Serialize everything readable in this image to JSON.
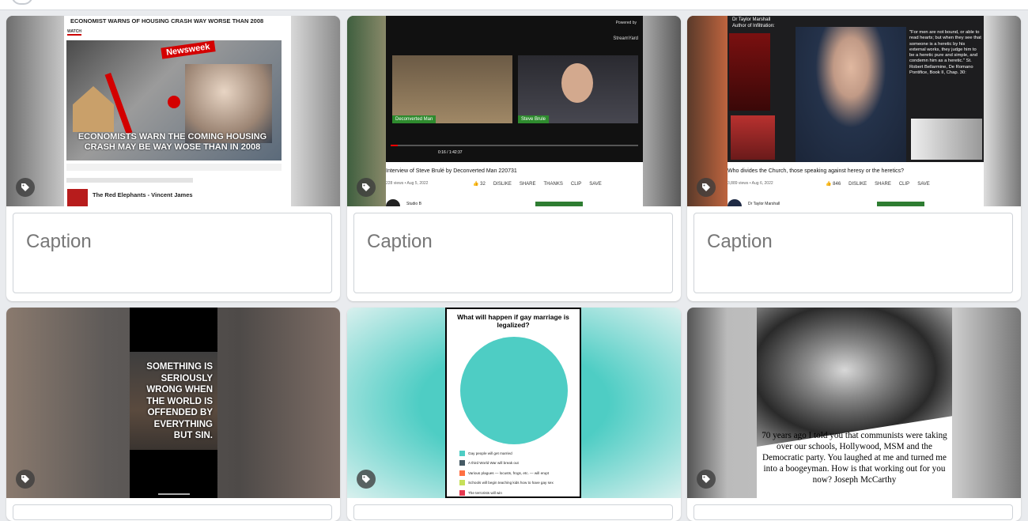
{
  "caption_placeholder": "Caption",
  "cards": [
    {
      "headline": "ECONOMIST WARNS OF HOUSING CRASH WAY WORSE THAN 2008",
      "watch": "WATCH",
      "overlay": "ECONOMISTS WARN THE COMING HOUSING CRASH MAY BE WAY WOSE THAN IN 2008",
      "channel": "The Red Elephants - Vincent James",
      "newsweek": "Newsweek",
      "caption": "Caption"
    },
    {
      "powered": "Powered by",
      "streamyard": "StreamYard",
      "guest_left": "Deconverted Man",
      "guest_right": "Steve Brule",
      "time": "0:16 / 1:42:37",
      "title": "Interview of Steve Brulé by Deconverted Man 220731",
      "meta": "228 views • Aug 5, 2022",
      "likes": "32",
      "dislike": "DISLIKE",
      "share": "SHARE",
      "thanks": "THANKS",
      "clip": "CLIP",
      "save": "SAVE",
      "channel": "Studio B",
      "caption": "Caption"
    },
    {
      "author": "Dr Taylor Marshall",
      "book": "Author of Infiltration:",
      "quote": "\"For men are not bound, or able to read hearts; but when they see that someone is a heretic by his external works, they judge him to be a heretic pure and simple, and condemn him as a heretic.\" St. Robert Bellarmine, De Romano Pontifice, Book II, Chap. 30:",
      "title": "Who divides the Church, those speaking against heresy or the heretics?",
      "meta": "3,889 views • Aug 6, 2022",
      "likes": "846",
      "dislike": "DISLIKE",
      "share": "SHARE",
      "clip": "CLIP",
      "save": "SAVE",
      "channel": "Dr Taylor Marshall",
      "caption": "Caption"
    },
    {
      "text": "SOMETHING IS SERIOUSLY WRONG WHEN THE WORLD IS OFFENDED BY EVERYTHING BUT SIN."
    },
    {
      "title": "What will happen if gay marriage is legalized?",
      "legend": [
        {
          "label": "Gay people will get married",
          "color": "#4ecdc4"
        },
        {
          "label": "A third World War will break out",
          "color": "#455a64"
        },
        {
          "label": "Various plagues — locusts, frogs, etc. — will erupt",
          "color": "#ff7043"
        },
        {
          "label": "Schools will begin teaching kids how to have gay sex",
          "color": "#c6e05a"
        },
        {
          "label": "The terrorists will win",
          "color": "#e53950"
        }
      ]
    },
    {
      "quote": "70 years ago I told you that communists were taking over our schools, Hollywood, MSM and the Democratic party. You laughed at me and turned me into a boogeyman. How is that working out for you now?  Joseph McCarthy"
    }
  ]
}
